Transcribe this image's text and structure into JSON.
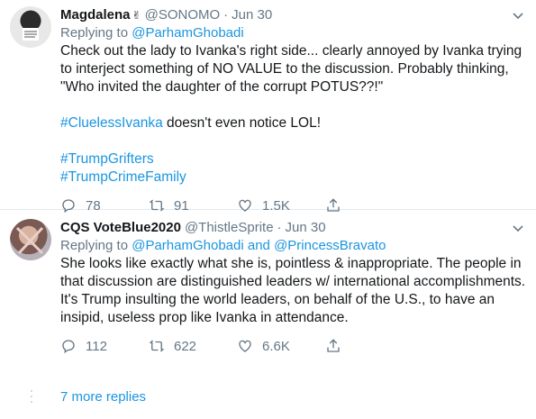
{
  "tweets": [
    {
      "display_name": "Magdalena",
      "handle": "@SONOMO",
      "dot": "·",
      "date": "Jun 30",
      "reply_prefix": "Replying to",
      "reply_to": "@ParhamGhobadi",
      "reply_conj": "",
      "reply_to2": "",
      "body_line1": "Check out the lady to Ivanka's right side... clearly annoyed by Ivanka trying to interject something of NO VALUE to the discussion. Probably thinking, \"Who invited the daughter of the corrupt POTUS??!\"",
      "hashtag_cluelessivanka": "#CluelessIvanka",
      "body_line2_rest": " doesn't even notice LOL!",
      "hashtag_trumpgrifters": "#TrumpGrifters",
      "hashtag_trumpcrimefamily": "#TrumpCrimeFamily",
      "replies": "78",
      "retweets": "91",
      "likes": "1.5K"
    },
    {
      "display_name": "CQS VoteBlue2020",
      "handle": "@ThistleSprite",
      "dot": "·",
      "date": "Jun 30",
      "reply_prefix": "Replying to",
      "reply_to": "@ParhamGhobadi",
      "reply_conj": "and",
      "reply_to2": "@PrincessBravato",
      "body": "She looks like exactly what she is, pointless & inappropriate. The people in that discussion are distinguished leaders w/ international accomplishments. It's Trump insulting the world leaders, on behalf of the U.S., to have an insipid, useless prop like Ivanka in attendance.",
      "replies": "112",
      "retweets": "622",
      "likes": "6.6K"
    }
  ],
  "more_replies": "7 more replies",
  "colors": {
    "link": "#1b95e0",
    "muted": "#657786",
    "text": "#14171a",
    "divider": "#e1e8ed"
  },
  "icons": {
    "reply": "reply-icon",
    "retweet": "retweet-icon",
    "like": "like-icon",
    "share": "share-icon",
    "caret": "chevron-down-icon",
    "emoji": "emoji-icon"
  }
}
